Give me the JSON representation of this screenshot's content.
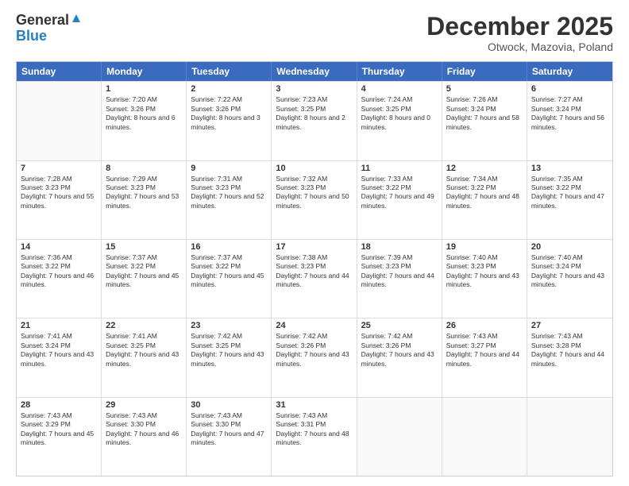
{
  "logo": {
    "general": "General",
    "blue": "Blue"
  },
  "title": "December 2025",
  "subtitle": "Otwock, Mazovia, Poland",
  "weekdays": [
    "Sunday",
    "Monday",
    "Tuesday",
    "Wednesday",
    "Thursday",
    "Friday",
    "Saturday"
  ],
  "weeks": [
    [
      {
        "day": "",
        "sunrise": "",
        "sunset": "",
        "daylight": ""
      },
      {
        "day": "1",
        "sunrise": "Sunrise: 7:20 AM",
        "sunset": "Sunset: 3:26 PM",
        "daylight": "Daylight: 8 hours and 6 minutes."
      },
      {
        "day": "2",
        "sunrise": "Sunrise: 7:22 AM",
        "sunset": "Sunset: 3:26 PM",
        "daylight": "Daylight: 8 hours and 3 minutes."
      },
      {
        "day": "3",
        "sunrise": "Sunrise: 7:23 AM",
        "sunset": "Sunset: 3:25 PM",
        "daylight": "Daylight: 8 hours and 2 minutes."
      },
      {
        "day": "4",
        "sunrise": "Sunrise: 7:24 AM",
        "sunset": "Sunset: 3:25 PM",
        "daylight": "Daylight: 8 hours and 0 minutes."
      },
      {
        "day": "5",
        "sunrise": "Sunrise: 7:26 AM",
        "sunset": "Sunset: 3:24 PM",
        "daylight": "Daylight: 7 hours and 58 minutes."
      },
      {
        "day": "6",
        "sunrise": "Sunrise: 7:27 AM",
        "sunset": "Sunset: 3:24 PM",
        "daylight": "Daylight: 7 hours and 56 minutes."
      }
    ],
    [
      {
        "day": "7",
        "sunrise": "Sunrise: 7:28 AM",
        "sunset": "Sunset: 3:23 PM",
        "daylight": "Daylight: 7 hours and 55 minutes."
      },
      {
        "day": "8",
        "sunrise": "Sunrise: 7:29 AM",
        "sunset": "Sunset: 3:23 PM",
        "daylight": "Daylight: 7 hours and 53 minutes."
      },
      {
        "day": "9",
        "sunrise": "Sunrise: 7:31 AM",
        "sunset": "Sunset: 3:23 PM",
        "daylight": "Daylight: 7 hours and 52 minutes."
      },
      {
        "day": "10",
        "sunrise": "Sunrise: 7:32 AM",
        "sunset": "Sunset: 3:23 PM",
        "daylight": "Daylight: 7 hours and 50 minutes."
      },
      {
        "day": "11",
        "sunrise": "Sunrise: 7:33 AM",
        "sunset": "Sunset: 3:22 PM",
        "daylight": "Daylight: 7 hours and 49 minutes."
      },
      {
        "day": "12",
        "sunrise": "Sunrise: 7:34 AM",
        "sunset": "Sunset: 3:22 PM",
        "daylight": "Daylight: 7 hours and 48 minutes."
      },
      {
        "day": "13",
        "sunrise": "Sunrise: 7:35 AM",
        "sunset": "Sunset: 3:22 PM",
        "daylight": "Daylight: 7 hours and 47 minutes."
      }
    ],
    [
      {
        "day": "14",
        "sunrise": "Sunrise: 7:36 AM",
        "sunset": "Sunset: 3:22 PM",
        "daylight": "Daylight: 7 hours and 46 minutes."
      },
      {
        "day": "15",
        "sunrise": "Sunrise: 7:37 AM",
        "sunset": "Sunset: 3:22 PM",
        "daylight": "Daylight: 7 hours and 45 minutes."
      },
      {
        "day": "16",
        "sunrise": "Sunrise: 7:37 AM",
        "sunset": "Sunset: 3:22 PM",
        "daylight": "Daylight: 7 hours and 45 minutes."
      },
      {
        "day": "17",
        "sunrise": "Sunrise: 7:38 AM",
        "sunset": "Sunset: 3:23 PM",
        "daylight": "Daylight: 7 hours and 44 minutes."
      },
      {
        "day": "18",
        "sunrise": "Sunrise: 7:39 AM",
        "sunset": "Sunset: 3:23 PM",
        "daylight": "Daylight: 7 hours and 44 minutes."
      },
      {
        "day": "19",
        "sunrise": "Sunrise: 7:40 AM",
        "sunset": "Sunset: 3:23 PM",
        "daylight": "Daylight: 7 hours and 43 minutes."
      },
      {
        "day": "20",
        "sunrise": "Sunrise: 7:40 AM",
        "sunset": "Sunset: 3:24 PM",
        "daylight": "Daylight: 7 hours and 43 minutes."
      }
    ],
    [
      {
        "day": "21",
        "sunrise": "Sunrise: 7:41 AM",
        "sunset": "Sunset: 3:24 PM",
        "daylight": "Daylight: 7 hours and 43 minutes."
      },
      {
        "day": "22",
        "sunrise": "Sunrise: 7:41 AM",
        "sunset": "Sunset: 3:25 PM",
        "daylight": "Daylight: 7 hours and 43 minutes."
      },
      {
        "day": "23",
        "sunrise": "Sunrise: 7:42 AM",
        "sunset": "Sunset: 3:25 PM",
        "daylight": "Daylight: 7 hours and 43 minutes."
      },
      {
        "day": "24",
        "sunrise": "Sunrise: 7:42 AM",
        "sunset": "Sunset: 3:26 PM",
        "daylight": "Daylight: 7 hours and 43 minutes."
      },
      {
        "day": "25",
        "sunrise": "Sunrise: 7:42 AM",
        "sunset": "Sunset: 3:26 PM",
        "daylight": "Daylight: 7 hours and 43 minutes."
      },
      {
        "day": "26",
        "sunrise": "Sunrise: 7:43 AM",
        "sunset": "Sunset: 3:27 PM",
        "daylight": "Daylight: 7 hours and 44 minutes."
      },
      {
        "day": "27",
        "sunrise": "Sunrise: 7:43 AM",
        "sunset": "Sunset: 3:28 PM",
        "daylight": "Daylight: 7 hours and 44 minutes."
      }
    ],
    [
      {
        "day": "28",
        "sunrise": "Sunrise: 7:43 AM",
        "sunset": "Sunset: 3:29 PM",
        "daylight": "Daylight: 7 hours and 45 minutes."
      },
      {
        "day": "29",
        "sunrise": "Sunrise: 7:43 AM",
        "sunset": "Sunset: 3:30 PM",
        "daylight": "Daylight: 7 hours and 46 minutes."
      },
      {
        "day": "30",
        "sunrise": "Sunrise: 7:43 AM",
        "sunset": "Sunset: 3:30 PM",
        "daylight": "Daylight: 7 hours and 47 minutes."
      },
      {
        "day": "31",
        "sunrise": "Sunrise: 7:43 AM",
        "sunset": "Sunset: 3:31 PM",
        "daylight": "Daylight: 7 hours and 48 minutes."
      },
      {
        "day": "",
        "sunrise": "",
        "sunset": "",
        "daylight": ""
      },
      {
        "day": "",
        "sunrise": "",
        "sunset": "",
        "daylight": ""
      },
      {
        "day": "",
        "sunrise": "",
        "sunset": "",
        "daylight": ""
      }
    ]
  ]
}
